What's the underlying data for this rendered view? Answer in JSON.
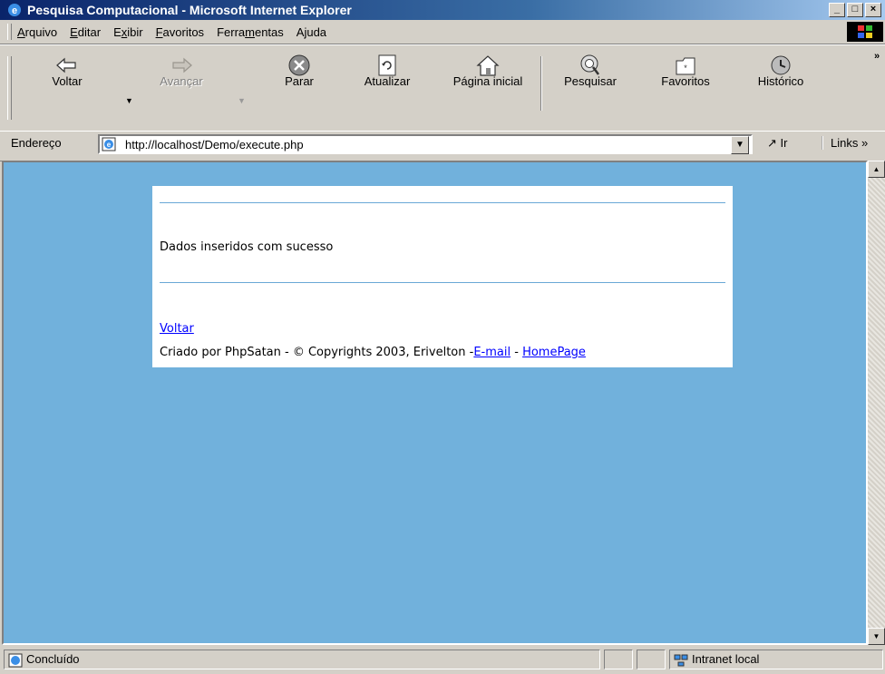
{
  "window": {
    "title": "Pesquisa Computacional - Microsoft Internet Explorer",
    "controls": [
      "_",
      "□",
      "×"
    ]
  },
  "menu": [
    {
      "label": "Arquivo",
      "accel_index": 0
    },
    {
      "label": "Editar",
      "accel_index": 0
    },
    {
      "label": "Exibir",
      "accel_index": 1
    },
    {
      "label": "Favoritos",
      "accel_index": 0
    },
    {
      "label": "Ferramentas",
      "accel_index": 5
    },
    {
      "label": "Ajuda",
      "accel_index": 1
    }
  ],
  "toolbar": {
    "back": "Voltar",
    "forward": "Avançar",
    "stop": "Parar",
    "refresh": "Atualizar",
    "home": "Página inicial",
    "search": "Pesquisar",
    "favorites": "Favoritos",
    "history": "Histórico"
  },
  "address": {
    "label": "Endereço",
    "url": "http://localhost/Demo/execute.php",
    "go": "Ir",
    "links": "Links »"
  },
  "page": {
    "message": "Dados inseridos com sucesso",
    "back_link": "Voltar",
    "footer_prefix": "Criado por PhpSatan - © Copyrights 2003, Erivelton -",
    "email_link": "E-mail",
    "footer_sep": " - ",
    "homepage_link": "HomePage"
  },
  "status": {
    "text": "Concluído",
    "zone": "Intranet local"
  },
  "colors": {
    "page_background": "#71b1dc",
    "link": "#0000ff",
    "rule": "#6aa8d6",
    "titlebar": "#0a246a"
  }
}
